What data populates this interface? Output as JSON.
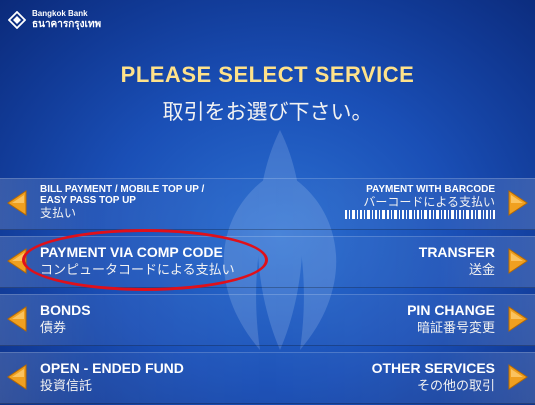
{
  "bank": {
    "name_en": "Bangkok Bank",
    "name_th": "ธนาคารกรุงเทพ"
  },
  "header": {
    "title_en": "PLEASE SELECT SERVICE",
    "title_jp": "取引をお選び下さい。"
  },
  "options": {
    "bill_payment": {
      "line1": "BILL PAYMENT / MOBILE TOP UP /",
      "line2": "EASY PASS TOP UP",
      "jp": "支払い"
    },
    "payment_barcode": {
      "en": "PAYMENT WITH BARCODE",
      "jp": "バーコードによる支払い"
    },
    "payment_comp_code": {
      "en": "PAYMENT VIA COMP CODE",
      "jp": "コンピュータコードによる支払い"
    },
    "transfer": {
      "en": "TRANSFER",
      "jp": "送金"
    },
    "bonds": {
      "en": "BONDS",
      "jp": "債券"
    },
    "pin_change": {
      "en": "PIN CHANGE",
      "jp": "暗証番号変更"
    },
    "open_ended_fund": {
      "en": "OPEN - ENDED FUND",
      "jp": "投資信託"
    },
    "other_services": {
      "en": "OTHER SERVICES",
      "jp": "その他の取引"
    }
  },
  "colors": {
    "title_accent": "#ffe28a",
    "arrow": "#f0a020",
    "highlight": "#e0101a",
    "background": "#1a4fb6"
  },
  "icons": {
    "logo": "bangkok-bank-logo",
    "arrow_left": "left-arrow-icon",
    "arrow_right": "right-arrow-icon"
  }
}
